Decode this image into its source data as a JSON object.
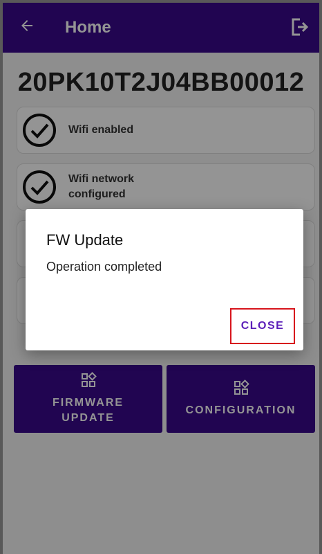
{
  "appbar": {
    "title": "Home",
    "back_icon": "arrow-left-icon",
    "logout_icon": "logout-icon"
  },
  "device": {
    "serial": "20PK10T2J04BB00012"
  },
  "status": [
    {
      "label": "Wifi enabled",
      "icon": "check-circle-icon"
    },
    {
      "label": "Wifi network configured",
      "icon": "check-circle-icon"
    }
  ],
  "actions": [
    {
      "label": "FIRMWARE UPDATE",
      "icon": "widgets-icon"
    },
    {
      "label": "CONFIGURATION",
      "icon": "widgets-icon"
    }
  ],
  "dialog": {
    "title": "FW Update",
    "message": "Operation completed",
    "close_label": "CLOSE"
  },
  "colors": {
    "primary": "#3a0a8c",
    "accent": "#5b1fb8",
    "highlight": "#d7141c"
  }
}
